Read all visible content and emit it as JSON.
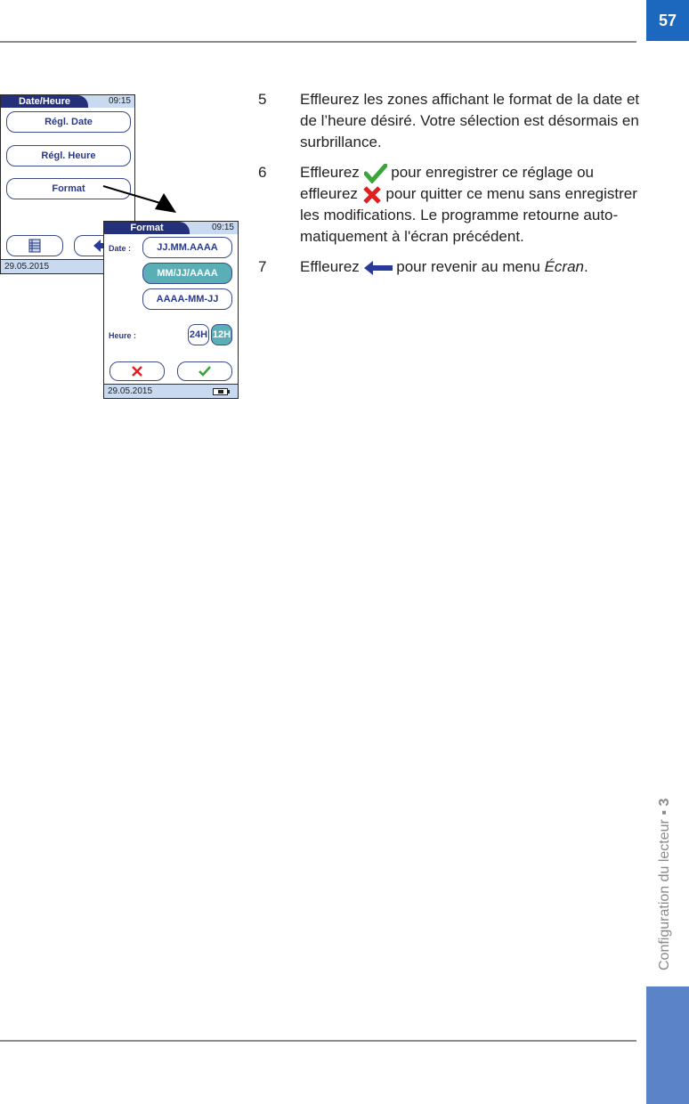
{
  "page": {
    "number": "57",
    "chapter": "Configuration du lecteur",
    "chapter_number": "3",
    "colors": {
      "page_number_bg": "#1b68be",
      "side_tab": "#5b84c8"
    }
  },
  "screen1": {
    "title": "Date/Heure",
    "time": "09:15",
    "buttons": [
      "Régl. Date",
      "Régl. Heure",
      "Format"
    ],
    "footer_date": "29.05.2015",
    "icons": [
      "menu-list-icon",
      "back-arrow-icon"
    ]
  },
  "screen2": {
    "title": "Format",
    "time": "09:15",
    "date_label": "Date :",
    "date_options": [
      {
        "label": "JJ.MM.AAAA",
        "selected": false
      },
      {
        "label": "MM/JJ/AAAA",
        "selected": true
      },
      {
        "label": "AAAA-MM-JJ",
        "selected": false
      }
    ],
    "time_label": "Heure :",
    "time_options": [
      {
        "label": "24H",
        "selected": false
      },
      {
        "label": "12H",
        "selected": true
      }
    ],
    "footer_date": "29.05.2015",
    "icons": [
      "cancel-x-icon",
      "confirm-check-icon",
      "battery-icon"
    ],
    "colors": {
      "selected": "#5aafb7",
      "header": "#24317a"
    }
  },
  "steps": [
    {
      "num": "5",
      "text": "Effleurez les zones affichant le format de la date et de l’heure désiré. Votre sélection est désormais en surbrillance."
    },
    {
      "num": "6",
      "parts": [
        "Effleurez",
        "pour enregistrer ce réglage ou effleurez",
        "pour quitter ce menu sans enregistrer les modifications. Le programme retourne auto-matiquement à l'écran précédent."
      ]
    },
    {
      "num": "7",
      "parts": [
        "Effleurez",
        "pour revenir au menu",
        "Écran",
        "."
      ]
    }
  ]
}
